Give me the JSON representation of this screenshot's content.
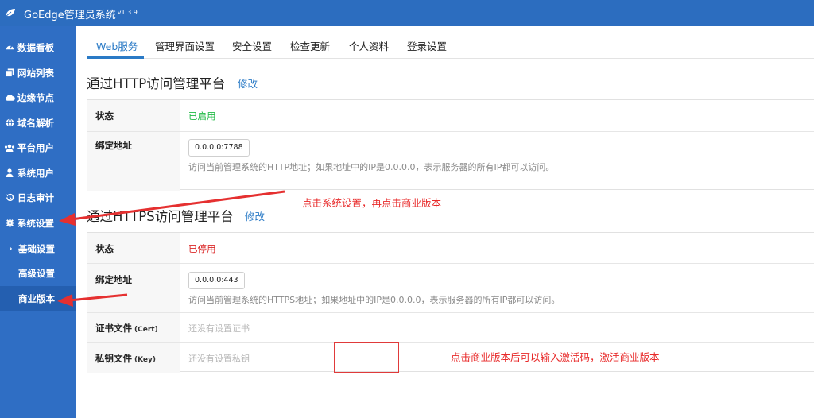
{
  "app": {
    "title": "GoEdge管理员系统",
    "version": "v1.3.9"
  },
  "sidebar": {
    "items": [
      {
        "label": "数据看板",
        "icon": "dashboard-icon"
      },
      {
        "label": "网站列表",
        "icon": "clone-icon"
      },
      {
        "label": "边缘节点",
        "icon": "cloud-icon"
      },
      {
        "label": "域名解析",
        "icon": "globe-icon"
      },
      {
        "label": "平台用户",
        "icon": "users-icon"
      },
      {
        "label": "系统用户",
        "icon": "user-icon"
      },
      {
        "label": "日志审计",
        "icon": "history-icon"
      },
      {
        "label": "系统设置",
        "icon": "gear-icon"
      }
    ],
    "sub_items": [
      {
        "label": "基础设置"
      },
      {
        "label": "高级设置"
      },
      {
        "label": "商业版本"
      }
    ]
  },
  "tabs": [
    {
      "label": "Web服务",
      "active": true
    },
    {
      "label": "管理界面设置"
    },
    {
      "label": "安全设置"
    },
    {
      "label": "检查更新"
    },
    {
      "label": "个人资料"
    },
    {
      "label": "登录设置"
    }
  ],
  "http": {
    "title": "通过HTTP访问管理平台",
    "edit": "修改",
    "status_label": "状态",
    "status_value": "已启用",
    "bind_label": "绑定地址",
    "bind_value": "0.0.0.0:7788",
    "bind_hint": "访问当前管理系统的HTTP地址；如果地址中的IP是0.0.0.0，表示服务器的所有IP都可以访问。"
  },
  "https": {
    "title": "通过HTTPS访问管理平台",
    "edit": "修改",
    "status_label": "状态",
    "status_value": "已停用",
    "bind_label": "绑定地址",
    "bind_value": "0.0.0.0:443",
    "bind_hint": "访问当前管理系统的HTTPS地址；如果地址中的IP是0.0.0.0，表示服务器的所有IP都可以访问。",
    "cert_label": "证书文件",
    "cert_sub": "(Cert)",
    "cert_value": "还没有设置证书",
    "key_label": "私钥文件",
    "key_sub": "(Key)",
    "key_value": "还没有设置私钥"
  },
  "annotations": {
    "note1": "点击系统设置，再点击商业版本",
    "note2": "点击商业版本后可以输入激活码，激活商业版本"
  },
  "colors": {
    "primary": "#2c6dbf",
    "sidebar": "#2f6ec4",
    "link": "#2a7ac6",
    "enabled": "#21ba45",
    "disabled": "#db2828",
    "annotation": "#e82a2a"
  }
}
